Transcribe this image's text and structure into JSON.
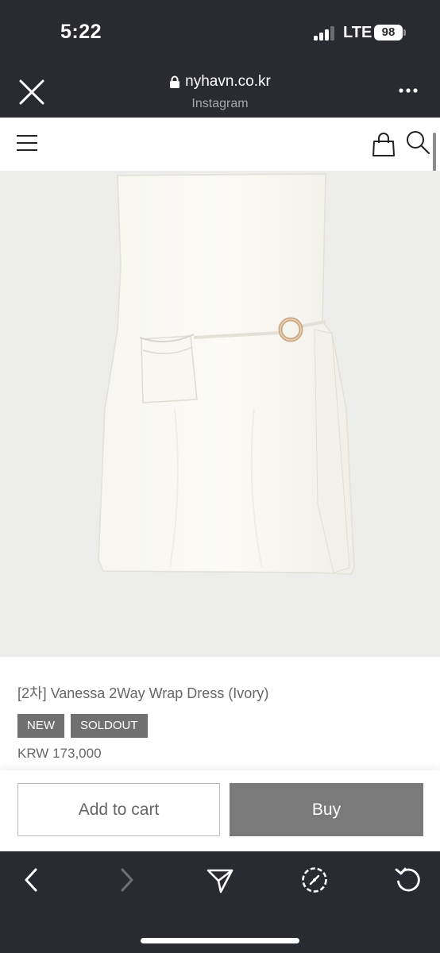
{
  "status_bar": {
    "time": "5:22",
    "network": "LTE",
    "battery": "98"
  },
  "browser": {
    "url": "nyhavn.co.kr",
    "source": "Instagram",
    "icons": {
      "close": "close-icon",
      "lock": "lock-icon",
      "more": "more-icon"
    }
  },
  "site_header": {
    "icons": [
      "menu-icon",
      "shopping-bag-icon",
      "search-icon"
    ]
  },
  "product": {
    "name": "[2차] Vanessa 2Way Wrap Dress (Ivory)",
    "badges": [
      "NEW",
      "SOLDOUT"
    ],
    "price": "KRW 173,000",
    "image_background": "#ededec"
  },
  "actions": {
    "add_to_cart": "Add to cart",
    "buy": "Buy"
  },
  "toolbar": {
    "icons": [
      "back-icon",
      "forward-icon",
      "share-icon",
      "safari-icon",
      "reload-icon"
    ]
  },
  "colors": {
    "chrome": "#2a2b30",
    "badge": "#707070",
    "buy_button": "#7a7a7a",
    "text_muted": "#666666"
  }
}
